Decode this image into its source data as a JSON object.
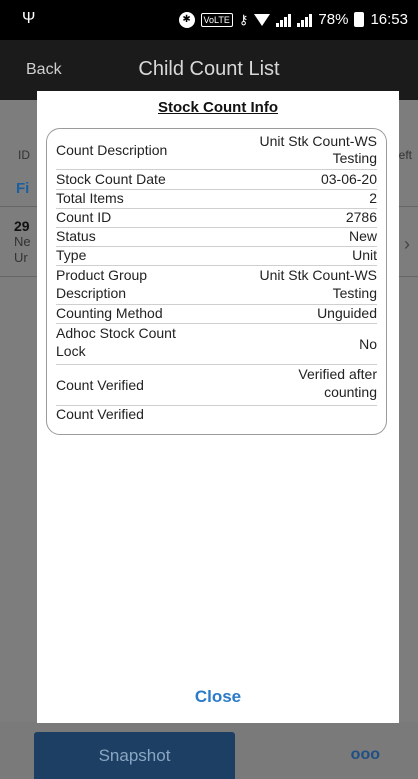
{
  "status_bar": {
    "usb_icon": "usb-icon",
    "volte": "VoLTE",
    "battery_percent": "78%",
    "time": "16:53"
  },
  "header": {
    "back_label": "Back",
    "title": "Child Count List"
  },
  "background": {
    "id_label": "ID",
    "eft_label": "eft",
    "fi_label": "Fi",
    "item_number": "29",
    "item_line2": "Ne",
    "item_line3": "Ur"
  },
  "modal": {
    "title": "Stock Count Info",
    "rows": [
      {
        "label": "Count Description",
        "value": "Unit Stk Count-WS Testing"
      },
      {
        "label": "Stock Count Date",
        "value": "03-06-20"
      },
      {
        "label": "Total Items",
        "value": "2"
      },
      {
        "label": "Count ID",
        "value": "2786"
      },
      {
        "label": "Status",
        "value": "New"
      },
      {
        "label": "Type",
        "value": "Unit"
      },
      {
        "label": "Product Group Description",
        "value": "Unit Stk Count-WS Testing"
      },
      {
        "label": "Counting Method",
        "value": "Unguided"
      },
      {
        "label": "Adhoc Stock Count Lock",
        "value": "No"
      },
      {
        "label": "Count Verified",
        "value": "Verified after counting"
      },
      {
        "label": "Count Verified",
        "value": ""
      }
    ],
    "close_label": "Close"
  },
  "footer": {
    "snapshot_label": "Snapshot",
    "more_label": "ooo"
  }
}
